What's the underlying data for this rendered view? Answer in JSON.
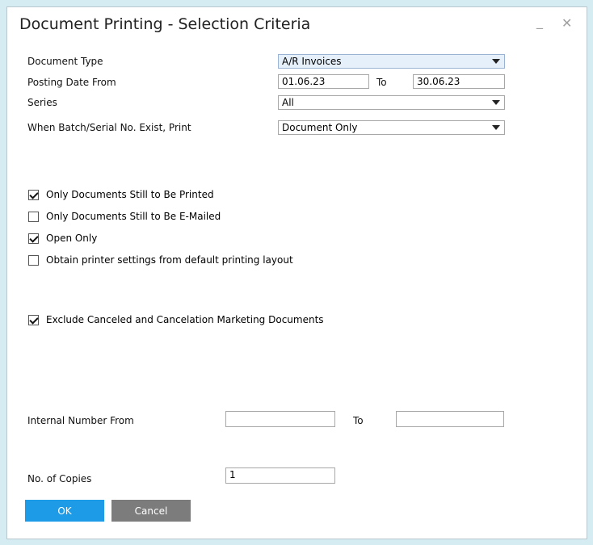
{
  "window": {
    "title": "Document Printing - Selection Criteria",
    "minimize": "_",
    "close": "✕"
  },
  "form": {
    "document_type": {
      "label": "Document Type",
      "value": "A/R Invoices"
    },
    "posting_date": {
      "label": "Posting Date From",
      "from": "01.06.23",
      "to_label": "To",
      "to": "30.06.23"
    },
    "series": {
      "label": "Series",
      "value": "All"
    },
    "batch_serial": {
      "label": "When Batch/Serial No. Exist, Print",
      "value": "Document Only"
    }
  },
  "checkboxes": [
    {
      "label": "Only Documents Still to Be Printed",
      "checked": true
    },
    {
      "label": "Only Documents Still to Be E-Mailed",
      "checked": false
    },
    {
      "label": "Open Only",
      "checked": true
    },
    {
      "label": "Obtain printer settings from default printing layout",
      "checked": false
    },
    {
      "label": "Exclude Canceled and Cancelation Marketing Documents",
      "checked": true
    }
  ],
  "internal_number": {
    "label": "Internal Number From",
    "from": "",
    "to_label": "To",
    "to": ""
  },
  "copies": {
    "label": "No. of Copies",
    "value": "1"
  },
  "buttons": {
    "ok": "OK",
    "cancel": "Cancel"
  }
}
